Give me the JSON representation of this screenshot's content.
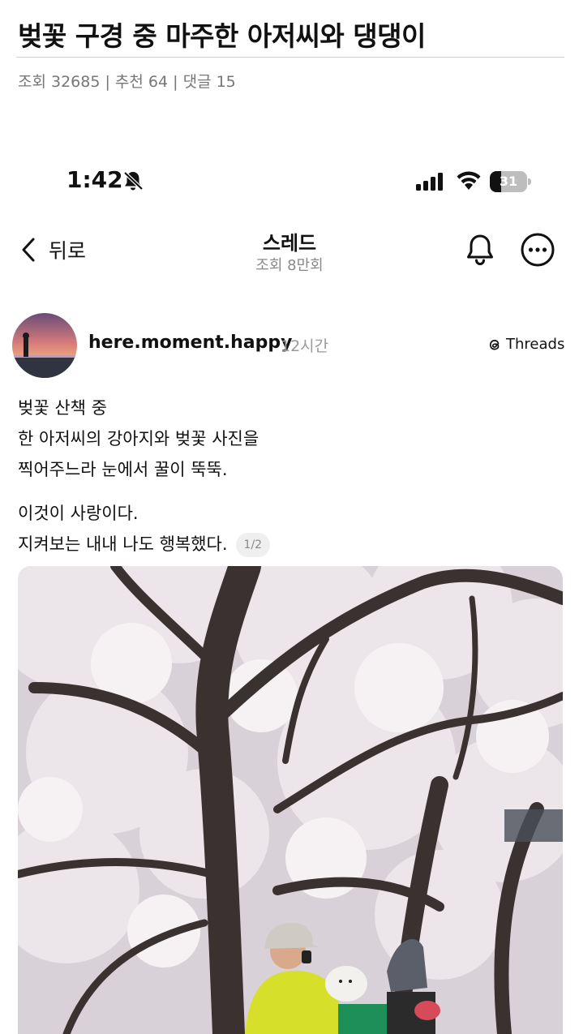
{
  "article": {
    "title": "벚꽃 구경 중 마주한 아저씨와 댕댕이",
    "meta": "조회 32685 | 추천 64 | 댓글 15"
  },
  "status_bar": {
    "time": "1:42",
    "battery": "31",
    "battery_level": 0.31,
    "icons": [
      "bell-slash-icon",
      "signal-icon",
      "wifi-icon",
      "battery-icon"
    ]
  },
  "nav": {
    "back_label": "뒤로",
    "title": "스레드",
    "subtitle": "조회 8만회",
    "icons": [
      "chevron-left-icon",
      "bell-icon",
      "more-icon"
    ]
  },
  "post": {
    "username": "here.moment.happy",
    "time": "12시간",
    "badge": "Threads",
    "lines": [
      "벚꽃 산책 중",
      "한 아저씨의 강아지와 벚꽃 사진을",
      "찍어주느라 눈에서 꿀이 뚝뚝.",
      "이것이 사랑이다.",
      "지켜보는 내내 나도 행복했다."
    ],
    "page_indicator": "1/2"
  },
  "colors": {
    "blossom": "#e9e1e6",
    "trunk": "#3a3230",
    "jacket": "#d6e02a",
    "meta_gray": "#777777"
  }
}
